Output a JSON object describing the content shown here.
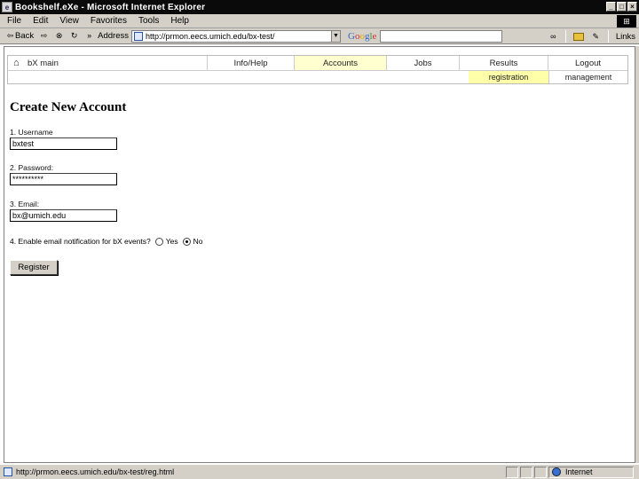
{
  "window": {
    "title": "Bookshelf.eXe - Microsoft Internet Explorer",
    "minimize_glyph": "_",
    "maximize_glyph": "□",
    "close_glyph": "×"
  },
  "menubar": {
    "items": [
      "File",
      "Edit",
      "View",
      "Favorites",
      "Tools",
      "Help"
    ]
  },
  "toolbar": {
    "back_label": "Back",
    "address_label": "Address",
    "address_value": "http://prmon.eecs.umich.edu/bx-test/",
    "google_label": "Google",
    "links_label": "Links"
  },
  "nav": {
    "home_label": "bX main",
    "items": [
      "Info/Help",
      "Accounts",
      "Jobs",
      "Results",
      "Logout"
    ],
    "active_item": "Accounts",
    "sub_items": [
      "registration",
      "management"
    ]
  },
  "form": {
    "title": "Create New Account",
    "username_label": "1. Username",
    "username_value": "bxtest",
    "password_label": "2. Password:",
    "password_value": "**********",
    "email_label": "3. Email:",
    "email_value": "bx@umich.edu",
    "notify_label": "4. Enable email notification for bX events?",
    "notify_yes": "Yes",
    "notify_no": "No",
    "notify_selected": "No",
    "submit_label": "Register"
  },
  "statusbar": {
    "text": "http://prmon.eecs.umich.edu/bx-test/reg.html",
    "zone": "Internet"
  },
  "colors": {
    "nav_active": "#ffffd0",
    "subnav_active": "#ffffaa",
    "chrome": "#d4d0c8"
  }
}
